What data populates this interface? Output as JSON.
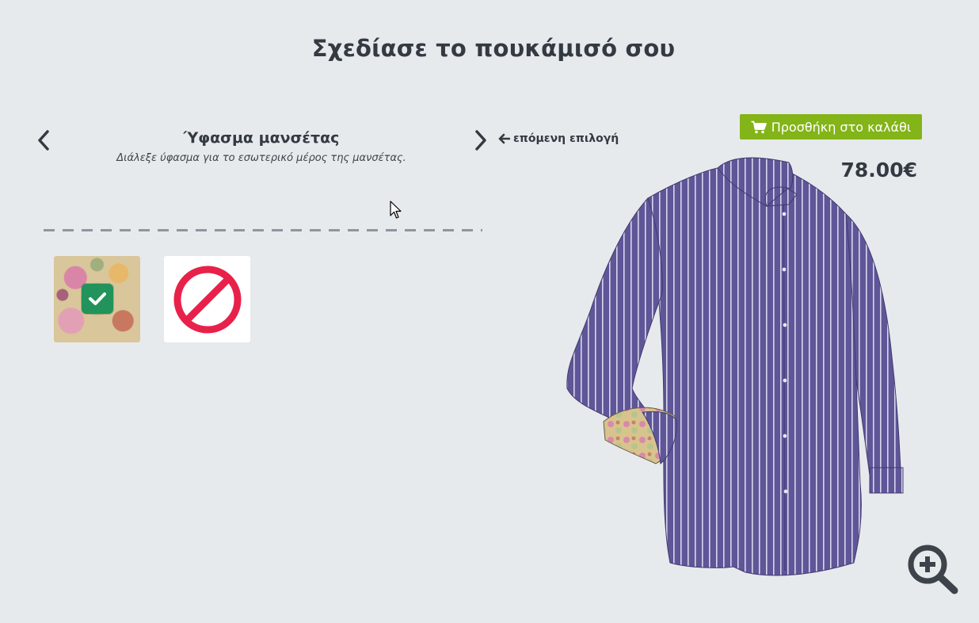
{
  "page": {
    "title": "Σχεδίασε το πουκάμισό σου"
  },
  "step": {
    "title": "Ύφασμα μανσέτας",
    "subtitle": "Διάλεξε ύφασμα για το εσωτερικό μέρος της μανσέτας.",
    "prev_icon": "chevron-left-icon",
    "next_icon": "chevron-right-icon",
    "next_option_label": "επόμενη επιλογή",
    "next_option_icon": "arrow-left-icon"
  },
  "swatches": [
    {
      "name": "floral-fabric",
      "selected": true,
      "icon": "checkmark-icon"
    },
    {
      "name": "no-fabric",
      "selected": false,
      "icon": "prohibited-icon"
    }
  ],
  "cart": {
    "label": "Προσθήκη στο καλάθι",
    "icon": "shopping-cart-icon",
    "price": "78.00€"
  },
  "preview": {
    "zoom_icon": "zoom-in-icon"
  },
  "colors": {
    "background": "#e7eaed",
    "text": "#343a42",
    "cart_button": "#83b418",
    "check_badge": "#21935b",
    "prohibited": "#e8214a",
    "shirt": "#5e5697"
  }
}
